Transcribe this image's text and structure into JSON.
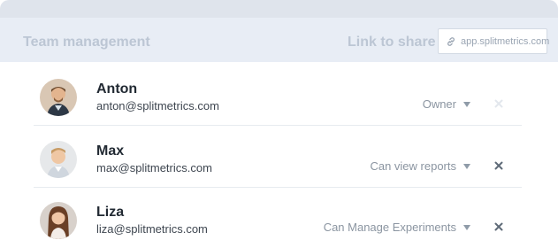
{
  "header": {
    "title": "Team management",
    "share_label": "Link to share",
    "share_link": "app.splitmetrics.com"
  },
  "members": [
    {
      "name": "Anton",
      "email": "anton@splitmetrics.com",
      "role": "Owner",
      "removable": false
    },
    {
      "name": "Max",
      "email": "max@splitmetrics.com",
      "role": "Can view reports",
      "removable": true
    },
    {
      "name": "Liza",
      "email": "liza@splitmetrics.com",
      "role": "Can Manage Experiments",
      "removable": true
    }
  ],
  "icons": {
    "link": "link-icon",
    "dropdown": "caret-down-icon",
    "remove": "close-icon",
    "avatar": "avatar"
  },
  "colors": {
    "header_bg": "#e8edf5",
    "header_text": "#bcc6d4",
    "remove_enabled": "#5f6b78",
    "remove_disabled": "#e3e7ed"
  }
}
